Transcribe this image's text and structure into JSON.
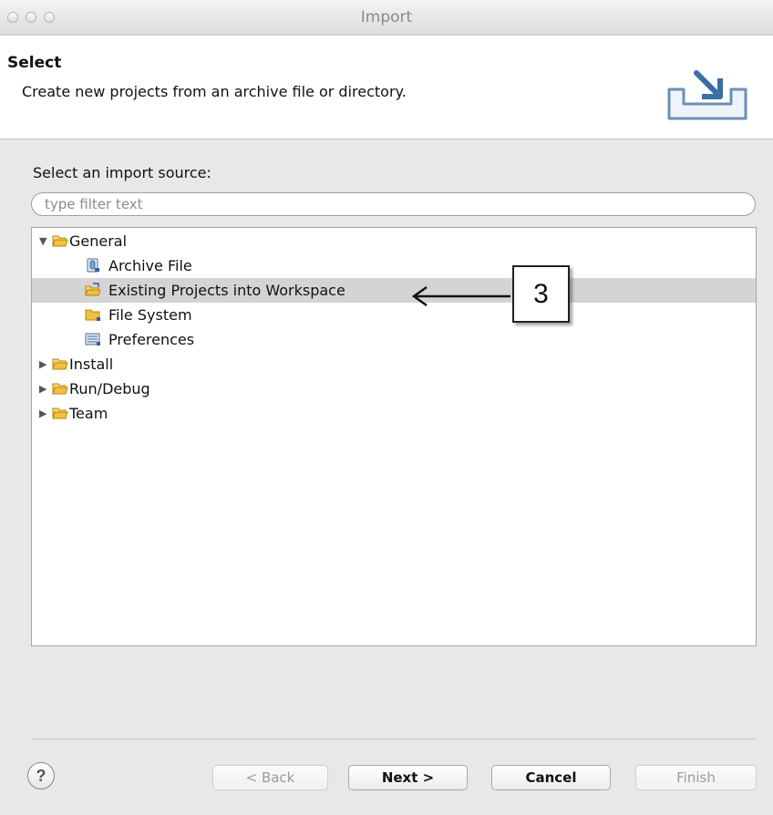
{
  "window": {
    "title": "Import"
  },
  "header": {
    "title": "Select",
    "description": "Create new projects from an archive file or directory."
  },
  "source": {
    "label": "Select an import source:",
    "filter_placeholder": "type filter text"
  },
  "tree": {
    "general": {
      "label": "General",
      "expanded": true
    },
    "general_children": [
      {
        "label": "Archive File",
        "icon": "archive-file-icon"
      },
      {
        "label": "Existing Projects into Workspace",
        "icon": "existing-projects-icon",
        "selected": true
      },
      {
        "label": "File System",
        "icon": "folder-icon"
      },
      {
        "label": "Preferences",
        "icon": "preferences-icon"
      }
    ],
    "install": {
      "label": "Install",
      "expanded": false
    },
    "run_debug": {
      "label": "Run/Debug",
      "expanded": false
    },
    "team": {
      "label": "Team",
      "expanded": false
    }
  },
  "callout": {
    "number": "3"
  },
  "buttons": {
    "back": "< Back",
    "next": "Next >",
    "cancel": "Cancel",
    "finish": "Finish"
  },
  "colors": {
    "selection": "#d4d4d4",
    "folder": "#f0c040"
  }
}
